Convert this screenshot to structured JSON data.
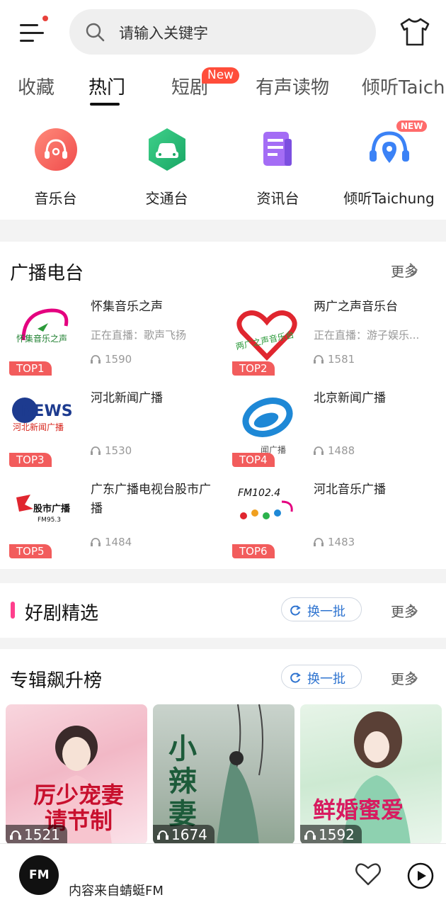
{
  "search": {
    "placeholder": "请输入关键字"
  },
  "tabs": [
    {
      "label": "收藏"
    },
    {
      "label": "热门"
    },
    {
      "label": "短剧",
      "badge": "New"
    },
    {
      "label": "有声读物"
    },
    {
      "label": "倾听Taichung"
    }
  ],
  "categories": [
    {
      "label": "音乐台",
      "icon": "music-icon"
    },
    {
      "label": "交通台",
      "icon": "car-icon"
    },
    {
      "label": "资讯台",
      "icon": "news-icon"
    },
    {
      "label": "倾听Taichung",
      "icon": "headphone-location-icon",
      "badge": "NEW"
    }
  ],
  "radio_section": {
    "title": "广播电台",
    "more": "更多",
    "stations": [
      {
        "rank": "TOP1",
        "name": "怀集音乐之声",
        "live": "正在直播：歌声飞扬",
        "listeners": "1590",
        "logo_text": "怀集音乐之声"
      },
      {
        "rank": "TOP2",
        "name": "两广之声音乐台",
        "live": "正在直播：游子娱乐...",
        "listeners": "1581",
        "logo_text": "两广之声音乐台"
      },
      {
        "rank": "TOP3",
        "name": "河北新闻广播",
        "live": "",
        "listeners": "1530",
        "logo_text": "NEWS",
        "logo_sub": "河北新闻广播"
      },
      {
        "rank": "TOP4",
        "name": "北京新闻广播",
        "live": "",
        "listeners": "1488",
        "logo_text": "闻广播"
      },
      {
        "rank": "TOP5",
        "name": "广东广播电视台股市广播",
        "live": "",
        "listeners": "1484",
        "logo_text": "股市广播",
        "logo_sub": "FM95.3"
      },
      {
        "rank": "TOP6",
        "name": "河北音乐广播",
        "live": "",
        "listeners": "1483",
        "logo_text": "FM102.4"
      }
    ]
  },
  "drama_section": {
    "title": "好剧精选",
    "swap": "换一批",
    "more": "更多"
  },
  "album_section": {
    "title": "专辑飙升榜",
    "swap": "换一批",
    "more": "更多",
    "albums": [
      {
        "title": "厉少宠妻请节制",
        "listeners": "1521"
      },
      {
        "title": "小辣妻",
        "listeners": "1674"
      },
      {
        "title": "鲜婚蜜爱",
        "listeners": "1592"
      }
    ]
  },
  "player": {
    "logo": "FM",
    "source": "内容来自蜻蜓FM"
  }
}
